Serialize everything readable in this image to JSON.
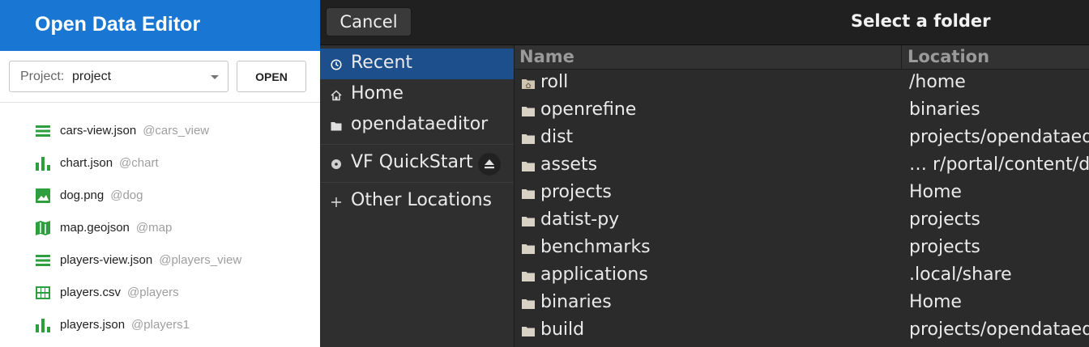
{
  "app": {
    "title": "Open Data Editor",
    "project_label": "Project:",
    "project_value": "project",
    "open_button": "OPEN",
    "files": [
      {
        "name": "cars-view.json",
        "alias": "@cars_view",
        "icon": "view-list-icon"
      },
      {
        "name": "chart.json",
        "alias": "@chart",
        "icon": "bar-chart-icon"
      },
      {
        "name": "dog.png",
        "alias": "@dog",
        "icon": "image-icon"
      },
      {
        "name": "map.geojson",
        "alias": "@map",
        "icon": "map-icon"
      },
      {
        "name": "players-view.json",
        "alias": "@players_view",
        "icon": "view-list-icon"
      },
      {
        "name": "players.csv",
        "alias": "@players",
        "icon": "table-icon"
      },
      {
        "name": "players.json",
        "alias": "@players1",
        "icon": "bar-chart-icon"
      }
    ],
    "colors": {
      "header": "#1976d2",
      "icon_green": "#2e9e3e"
    }
  },
  "dialog": {
    "cancel": "Cancel",
    "title": "Select a folder",
    "places": [
      {
        "label": "Recent",
        "icon": "clock-icon",
        "active": true
      },
      {
        "label": "Home",
        "icon": "home-icon"
      },
      {
        "label": "opendataeditor",
        "icon": "folder-icon"
      },
      {
        "label": "VF QuickStart",
        "icon": "disc-icon"
      },
      {
        "label": "Other Locations",
        "icon": "plus-icon"
      }
    ],
    "columns": {
      "name": "Name",
      "location": "Location"
    },
    "rows": [
      {
        "name": "roll",
        "location": "/home",
        "icon": "home-folder-icon"
      },
      {
        "name": "openrefine",
        "location": "binaries",
        "icon": "folder-icon"
      },
      {
        "name": "dist",
        "location": "projects/opendataeditor",
        "icon": "folder-icon"
      },
      {
        "name": "assets",
        "location": "… r/portal/content/docs",
        "icon": "folder-icon"
      },
      {
        "name": "projects",
        "location": "Home",
        "icon": "folder-icon"
      },
      {
        "name": "datist-py",
        "location": "projects",
        "icon": "folder-icon"
      },
      {
        "name": "benchmarks",
        "location": "projects",
        "icon": "folder-icon"
      },
      {
        "name": "applications",
        "location": ".local/share",
        "icon": "folder-icon"
      },
      {
        "name": "binaries",
        "location": "Home",
        "icon": "folder-icon"
      },
      {
        "name": "build",
        "location": "projects/opendataeditor",
        "icon": "folder-icon"
      }
    ],
    "colors": {
      "bg": "#2b2b2b",
      "selected": "#1c4f8c"
    }
  }
}
